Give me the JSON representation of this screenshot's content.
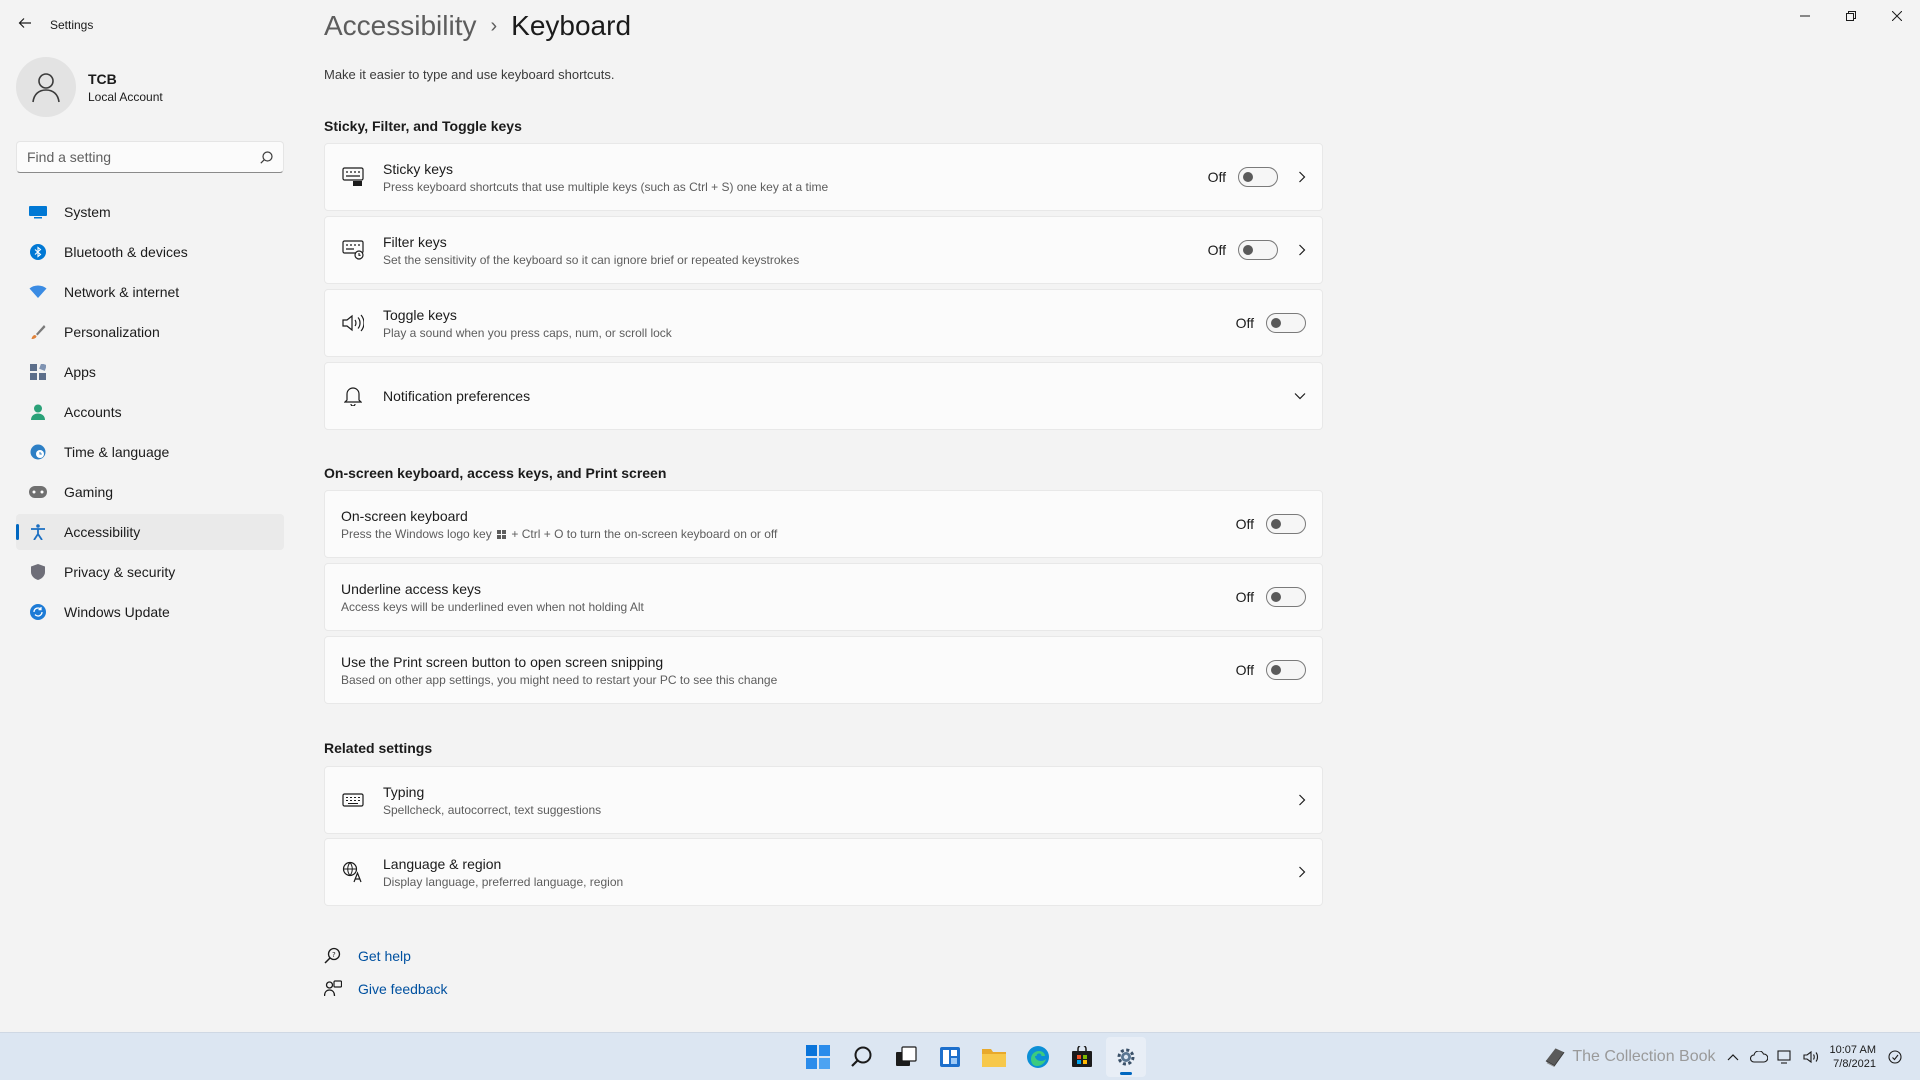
{
  "window": {
    "app_title": "Settings"
  },
  "profile": {
    "name": "TCB",
    "account_type": "Local Account"
  },
  "search": {
    "placeholder": "Find a setting"
  },
  "sidebar": {
    "items": [
      {
        "label": "System",
        "icon": "monitor-icon",
        "color": "#0078d4"
      },
      {
        "label": "Bluetooth & devices",
        "icon": "bluetooth-icon",
        "color": "#0078d4"
      },
      {
        "label": "Network & internet",
        "icon": "wifi-icon",
        "color": "#3a8be3"
      },
      {
        "label": "Personalization",
        "icon": "brush-icon",
        "color": "#e0823a"
      },
      {
        "label": "Apps",
        "icon": "apps-icon",
        "color": "#5c6e8a"
      },
      {
        "label": "Accounts",
        "icon": "person-icon",
        "color": "#2aa178"
      },
      {
        "label": "Time & language",
        "icon": "globe-clock-icon",
        "color": "#2d7fc5"
      },
      {
        "label": "Gaming",
        "icon": "gamepad-icon",
        "color": "#707070"
      },
      {
        "label": "Accessibility",
        "icon": "accessibility-icon",
        "color": "#1b6fc2",
        "active": true
      },
      {
        "label": "Privacy & security",
        "icon": "shield-icon",
        "color": "#6e6e78"
      },
      {
        "label": "Windows Update",
        "icon": "update-icon",
        "color": "#1d7bd6"
      }
    ]
  },
  "breadcrumb": {
    "parent": "Accessibility",
    "separator": "›",
    "current": "Keyboard"
  },
  "page_description": "Make it easier to type and use keyboard shortcuts.",
  "sections": {
    "sticky": {
      "title": "Sticky, Filter, and Toggle keys",
      "cards": [
        {
          "title": "Sticky keys",
          "subtitle": "Press keyboard shortcuts that use multiple keys (such as Ctrl + S) one key at a time",
          "state": "Off",
          "icon": "sticky-keys-icon"
        },
        {
          "title": "Filter keys",
          "subtitle": "Set the sensitivity of the keyboard so it can ignore brief or repeated keystrokes",
          "state": "Off",
          "icon": "filter-keys-icon"
        },
        {
          "title": "Toggle keys",
          "subtitle": "Play a sound when you press caps, num, or scroll lock",
          "state": "Off",
          "icon": "speaker-icon"
        },
        {
          "title": "Notification preferences",
          "icon": "bell-icon"
        }
      ]
    },
    "onscreen": {
      "title": "On-screen keyboard, access keys, and Print screen",
      "cards": [
        {
          "title": "On-screen keyboard",
          "subtitle_before": "Press the Windows logo key",
          "subtitle_after": "+ Ctrl + O to turn the on-screen keyboard on or off",
          "state": "Off"
        },
        {
          "title": "Underline access keys",
          "subtitle": "Access keys will be underlined even when not holding Alt",
          "state": "Off"
        },
        {
          "title": "Use the Print screen button to open screen snipping",
          "subtitle": "Based on other app settings, you might need to restart your PC to see this change",
          "state": "Off"
        }
      ]
    },
    "related": {
      "title": "Related settings",
      "cards": [
        {
          "title": "Typing",
          "subtitle": "Spellcheck, autocorrect, text suggestions",
          "icon": "keyboard-icon"
        },
        {
          "title": "Language & region",
          "subtitle": "Display language, preferred language, region",
          "icon": "language-icon"
        }
      ]
    }
  },
  "help": {
    "get_help": "Get help",
    "give_feedback": "Give feedback"
  },
  "taskbar": {
    "watermark": "The Collection Book",
    "time": "10:07 AM",
    "date": "7/8/2021"
  },
  "colors": {
    "accent": "#0067c0",
    "link": "#0051a0",
    "background": "#f3f3f3",
    "card": "#fbfbfb"
  }
}
